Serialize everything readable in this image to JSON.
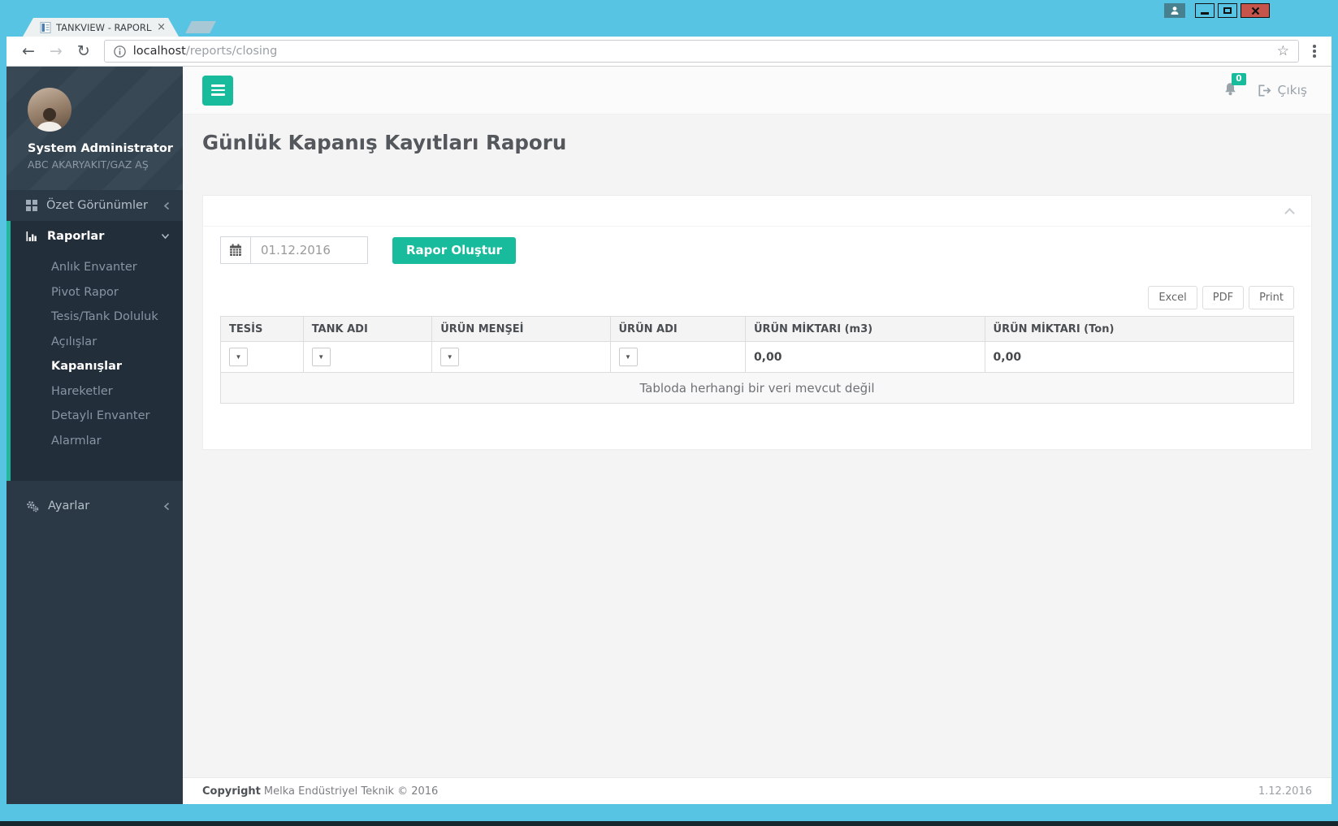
{
  "window": {
    "tab_title": "TANKVIEW - RAPORLAR",
    "url_host": "localhost",
    "url_path": "/reports/closing"
  },
  "icons": {
    "back": "←",
    "forward": "→",
    "reload": "↻",
    "star": "☆",
    "tab_close": "×",
    "dropdown": "▼"
  },
  "sidebar": {
    "user": {
      "name": "System Administrator",
      "company": "ABC AKARYAKIT/GAZ AŞ"
    },
    "menu": [
      {
        "label": "Özet Görünümler"
      },
      {
        "label": "Raporlar",
        "children": [
          "Anlık Envanter",
          "Pivot Rapor",
          "Tesis/Tank Doluluk",
          "Açılışlar",
          "Kapanışlar",
          "Hareketler",
          "Detaylı Envanter",
          "Alarmlar"
        ],
        "active_child": "Kapanışlar"
      },
      {
        "label": "Ayarlar"
      }
    ]
  },
  "topbar": {
    "notification_count": "0",
    "logout_label": "Çıkış"
  },
  "page": {
    "title": "Günlük Kapanış Kayıtları Raporu"
  },
  "report_form": {
    "date_value": "01.12.2016",
    "generate_label": "Rapor Oluştur"
  },
  "export_buttons": [
    "Excel",
    "PDF",
    "Print"
  ],
  "table": {
    "columns": [
      "TESİS",
      "TANK ADI",
      "ÜRÜN MENŞEİ",
      "ÜRÜN ADI",
      "ÜRÜN MİKTARI (m3)",
      "ÜRÜN MİKTARI (Ton)"
    ],
    "filter_totals": {
      "m3": "0,00",
      "ton": "0,00"
    },
    "empty_message": "Tabloda herhangi bir veri mevcut değil"
  },
  "footer": {
    "copyright_bold": "Copyright",
    "copyright_rest": "Melka Endüstriyel Teknik © 2016",
    "date": "1.12.2016"
  },
  "colors": {
    "accent_teal": "#18bc9c",
    "window_frame": "#58c4e4",
    "sidebar_bg": "#2b3845",
    "close_red": "#c7544b"
  }
}
